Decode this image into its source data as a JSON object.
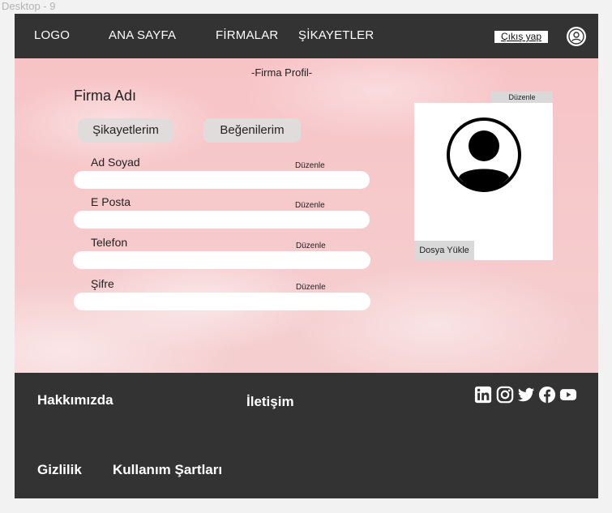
{
  "frame_label": "Desktop - 9",
  "header": {
    "logo": "LOGO",
    "nav": [
      "ANA SAYFA",
      "FİRMALAR",
      "ŞİKAYETLER"
    ],
    "logout_label": "Çıkış yap",
    "user_icon": "user-circle-icon"
  },
  "main": {
    "subtitle": "-Firma Profil-",
    "company_name": "Firma Adı",
    "buttons": [
      "Şikayetlerim",
      "Beğenilerim"
    ],
    "fields": [
      {
        "label": "Ad Soyad",
        "edit": "Düzenle",
        "value": ""
      },
      {
        "label": "E Posta",
        "edit": "Düzenle",
        "value": ""
      },
      {
        "label": "Telefon",
        "edit": "Düzenle",
        "value": ""
      },
      {
        "label": "Şifre",
        "edit": "Düzenle",
        "value": ""
      }
    ],
    "photo": {
      "edit_label": "Düzenle",
      "upload_label": "Dosya Yükle",
      "icon": "avatar-icon"
    }
  },
  "footer": {
    "about": "Hakkımızda",
    "contact": "İletişim",
    "privacy": "Gizlilik",
    "terms": "Kullanım Şartları",
    "social_icons": [
      "linkedin-icon",
      "instagram-icon",
      "twitter-icon",
      "facebook-icon",
      "youtube-icon"
    ]
  },
  "colors": {
    "header_bg": "#333333",
    "footer_bg": "#333333",
    "hero_pink": "#f7c3c6",
    "pill_bg": "#e1dcdc"
  }
}
